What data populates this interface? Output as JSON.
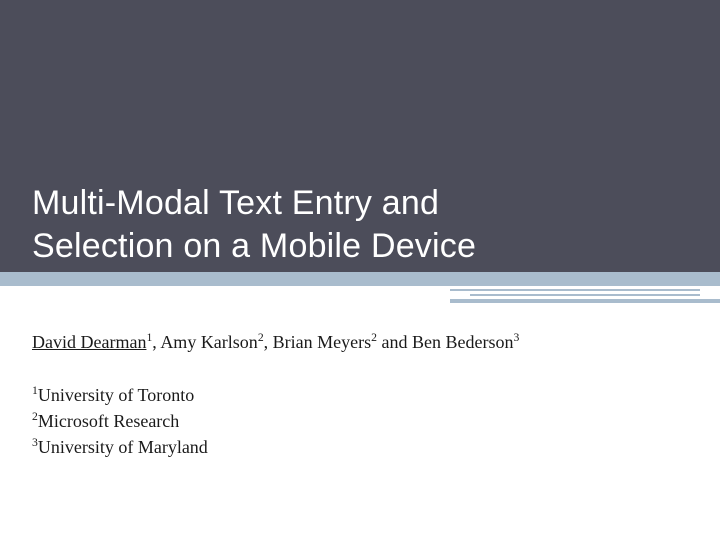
{
  "title": {
    "line1": "Multi-Modal Text Entry and",
    "line2": "Selection on a Mobile Device"
  },
  "authors": {
    "lead_name": "David Dearman",
    "lead_sup": "1",
    "sep1": ", ",
    "a2_name": "Amy Karlson",
    "a2_sup": "2",
    "sep2": ", ",
    "a3_name": "Brian Meyers",
    "a3_sup": "2",
    "sep3": " and ",
    "a4_name": "Ben Bederson",
    "a4_sup": "3"
  },
  "affiliations": {
    "a1_sup": "1",
    "a1_text": "University of Toronto",
    "a2_sup": "2",
    "a2_text": "Microsoft Research",
    "a3_sup": "3",
    "a3_text": "University of Maryland"
  }
}
